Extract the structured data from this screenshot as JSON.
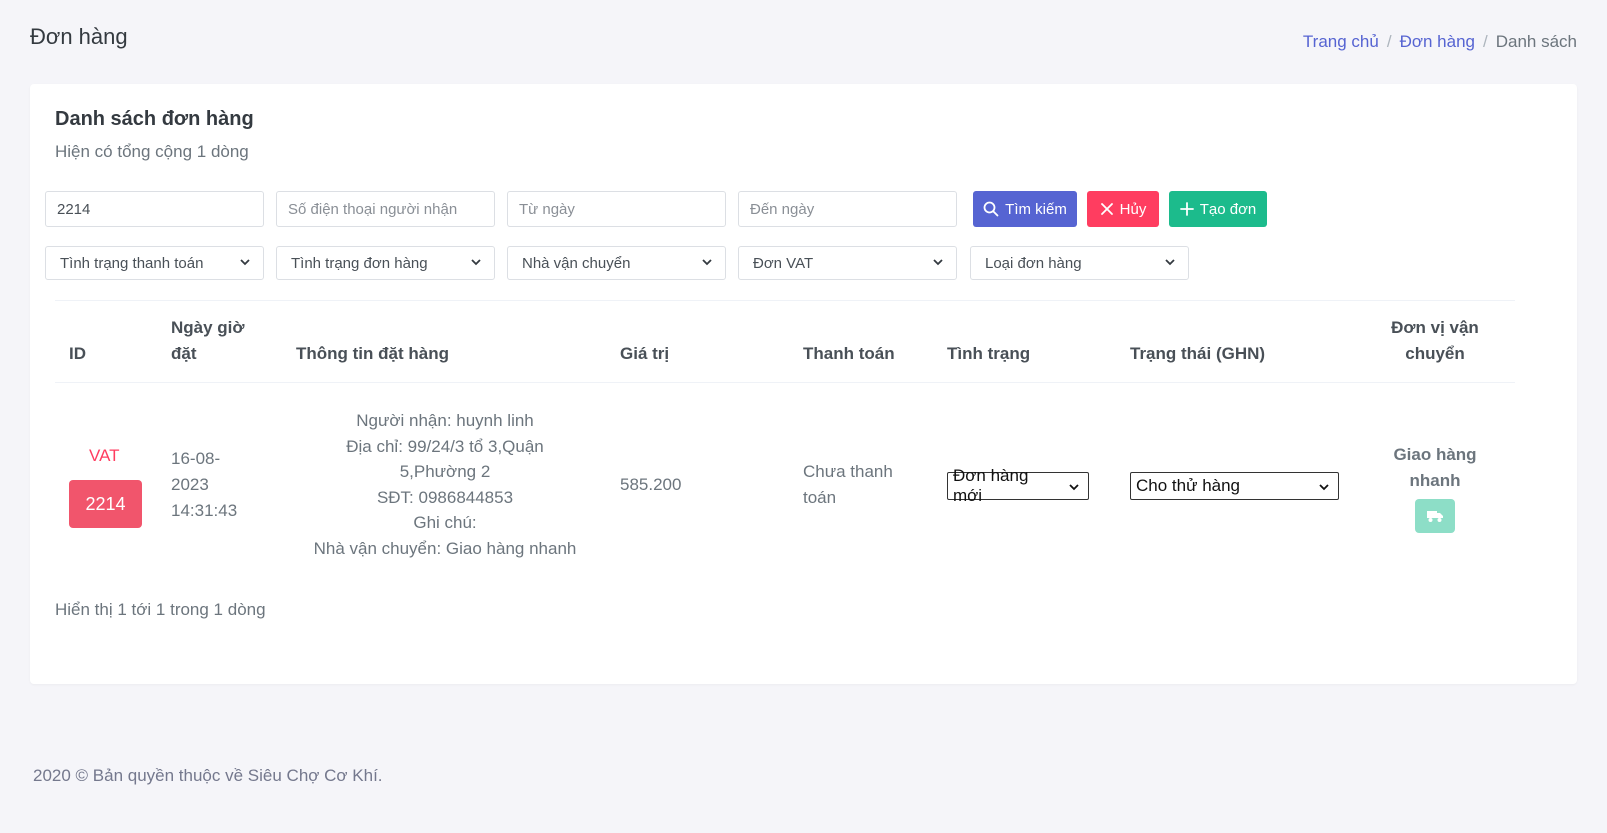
{
  "header": {
    "title": "Đơn hàng",
    "breadcrumb": [
      "Trang chủ",
      "Đơn hàng",
      "Danh sách"
    ],
    "breadcrumb_sep": "/"
  },
  "card": {
    "title": "Danh sách đơn hàng",
    "subtitle": "Hiện có tổng cộng 1 dòng"
  },
  "filters": {
    "order_id_value": "2214",
    "phone_placeholder": "Số điện thoại người nhận",
    "from_date_placeholder": "Từ ngày",
    "to_date_placeholder": "Đến ngày",
    "search_label": "Tìm kiếm",
    "cancel_label": "Hủy",
    "create_label": "Tạo đơn",
    "payment_status": "Tình trạng thanh toán",
    "order_status": "Tình trạng đơn hàng",
    "carrier": "Nhà vận chuyển",
    "vat": "Đơn VAT",
    "order_type": "Loại đơn hàng"
  },
  "table": {
    "headers": {
      "id": "ID",
      "date_line1": "Ngày giờ",
      "date_line2": "đặt",
      "info": "Thông tin đặt hàng",
      "value": "Giá trị",
      "payment": "Thanh toán",
      "status": "Tình trạng",
      "ghn": "Trạng thái (GHN)",
      "carrier_line1": "Đơn vị vận",
      "carrier_line2": "chuyển"
    },
    "rows": [
      {
        "vat": "VAT",
        "id": "2214",
        "date": "16-08-",
        "year": "2023",
        "time": "14:31:43",
        "info": [
          "Người nhận: huynh linh",
          "Địa chỉ: 99/24/3 tổ 3,Quận",
          "5,Phường 2",
          "SĐT: 0986844853",
          "Ghi chú:",
          "Nhà vận chuyển: Giao hàng nhanh"
        ],
        "value": "585.200",
        "payment_line1": "Chưa thanh",
        "payment_line2": "toán",
        "status": "Đơn hàng mới",
        "ghn": "Cho thử hàng",
        "carrier_line1": "Giao hàng",
        "carrier_line2": "nhanh"
      }
    ]
  },
  "pagination": {
    "showing": "Hiển thị 1 tới 1 trong 1 dòng"
  },
  "footer": {
    "text": "2020 © Bản quyền thuộc về Siêu Chợ Cơ Khí."
  },
  "colors": {
    "primary": "#5664d2",
    "danger": "#ff3d60",
    "success": "#1cbb8c"
  },
  "icons": {
    "search": "search-icon",
    "cancel": "close-icon",
    "create": "plus-icon",
    "truck": "truck-icon",
    "dropdown": "chevron-down-icon"
  }
}
